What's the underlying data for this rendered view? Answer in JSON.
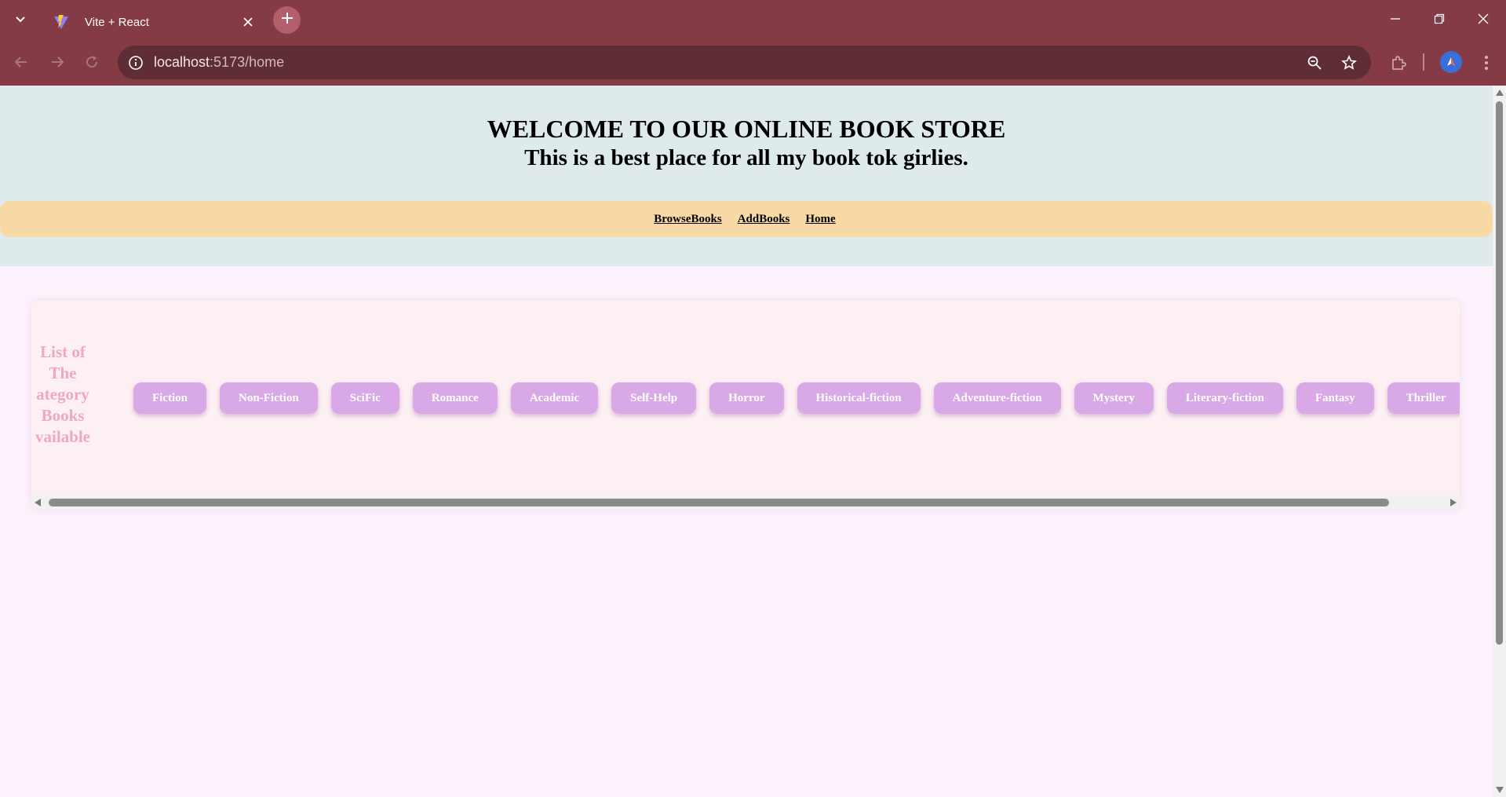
{
  "browser": {
    "tab_title": "Vite + React",
    "url_host": "localhost",
    "url_path": ":5173/home",
    "icons": [
      "tab-list-icon",
      "vite-favicon-icon",
      "close-icon",
      "plus-icon",
      "minimize-icon",
      "restore-icon",
      "window-close-icon",
      "back-icon",
      "forward-icon",
      "reload-icon",
      "site-info-icon",
      "zoom-icon",
      "star-icon",
      "extensions-icon",
      "profile-icon",
      "menu-icon"
    ],
    "accent_color": "#853b45"
  },
  "header": {
    "title": "WELCOME TO OUR ONLINE BOOK STORE",
    "subtitle": "This is a best place for all my book tok girlies."
  },
  "nav": {
    "links": [
      "BrowseBooks",
      "AddBooks",
      "Home"
    ]
  },
  "categories": {
    "heading_lines": [
      "List of",
      "The",
      "ategory",
      "Books",
      "vailable"
    ],
    "items": [
      "Fiction",
      "Non-Fiction",
      "SciFic",
      "Romance",
      "Academic",
      "Self-Help",
      "Horror",
      "Historical-fiction",
      "Adventure-fiction",
      "Mystery",
      "Literary-fiction",
      "Fantasy",
      "Thriller"
    ],
    "button_color": "#d8a9e6",
    "heading_color": "#f0a7bf"
  }
}
